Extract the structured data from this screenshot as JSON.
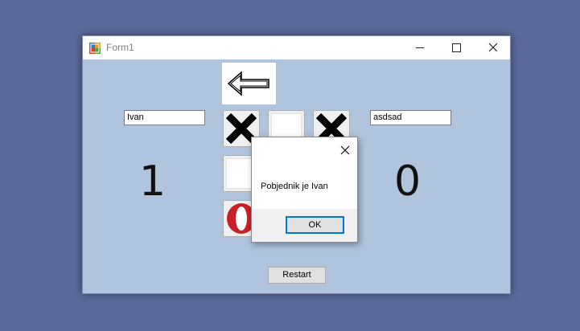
{
  "window": {
    "title": "Form1",
    "icon": "winforms-app-icon",
    "controls": [
      "minimize-icon",
      "maximize-icon",
      "close-icon"
    ]
  },
  "players": {
    "left_name": "Ivan",
    "right_name": "asdsad",
    "left_score": "1",
    "right_score": "0"
  },
  "turn_indicator": {
    "icon": "arrow-left-icon"
  },
  "board": [
    [
      "X",
      "",
      "X"
    ],
    [
      "",
      "",
      ""
    ],
    [
      "O",
      "",
      ""
    ]
  ],
  "buttons": {
    "restart": "Restart"
  },
  "dialog": {
    "message": "Pobjednik je Ivan",
    "ok_label": "OK"
  },
  "colors": {
    "desktop": "#5b6a9a",
    "form_background": "#b0c4de",
    "o_mark": "#cc1f25",
    "focus_border": "#0078d7"
  }
}
